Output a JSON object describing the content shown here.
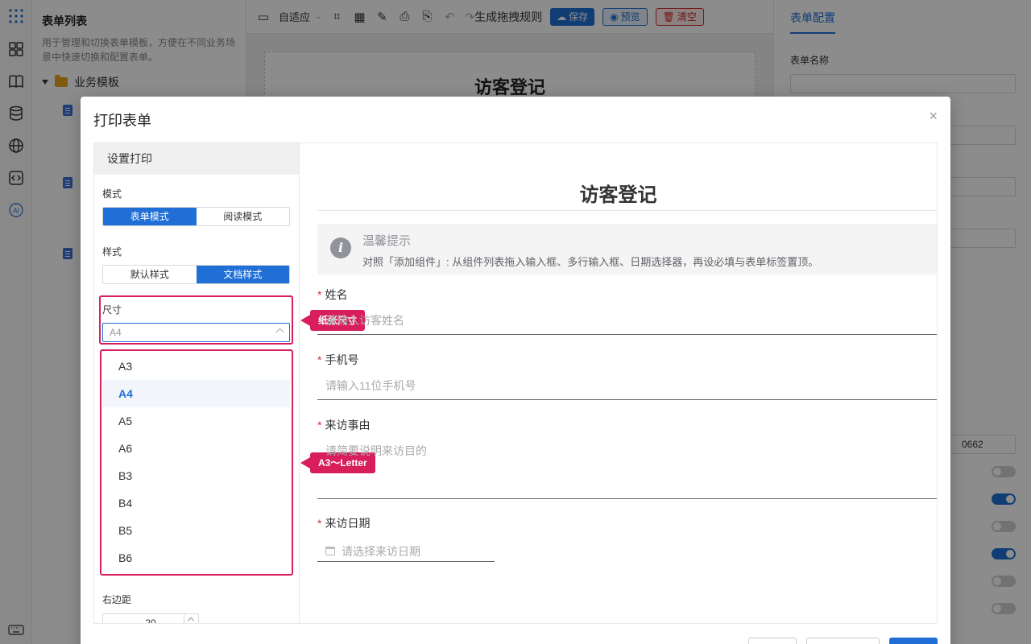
{
  "sidebar": {
    "title": "表单列表",
    "description": "用于管理和切换表单模板，方便在不同业务场景中快速切换和配置表单。",
    "folder": "业务模板"
  },
  "toolbar": {
    "adapt_label": "自适应",
    "generate_rules": "生成拖拽规则",
    "save": "保存",
    "preview": "预览",
    "clear": "清空"
  },
  "canvas": {
    "title": "访客登记"
  },
  "config": {
    "tab": "表单配置",
    "form_name_label": "表单名称",
    "partial_value": "0662"
  },
  "modal": {
    "title": "打印表单",
    "close": "×",
    "settings": {
      "header": "设置打印",
      "mode_label": "模式",
      "mode_options": [
        "表单模式",
        "阅读模式"
      ],
      "style_label": "样式",
      "style_options": [
        "默认样式",
        "文档样式"
      ],
      "size_label": "尺寸",
      "size_value": "A4",
      "size_options": [
        "A3",
        "A4",
        "A5",
        "A6",
        "B3",
        "B4",
        "B5",
        "B6"
      ],
      "right_margin_label": "右边距",
      "right_margin_value": "20"
    },
    "callouts": {
      "paper_size": "纸张尺寸",
      "range": "A3～Letter"
    },
    "preview": {
      "title": "访客登记",
      "notice_title": "温馨提示",
      "notice_desc": "对照「添加组件」: 从组件列表拖入输入框、多行输入框、日期选择器，再设必填与表单标签置顶。",
      "required_mark": "*",
      "fields": [
        {
          "label": "姓名",
          "placeholder": "请输入访客姓名"
        },
        {
          "label": "手机号",
          "placeholder": "请输入11位手机号"
        },
        {
          "label": "来访事由",
          "placeholder": "请简要说明来访目的"
        },
        {
          "label": "来访日期",
          "placeholder": "请选择来访日期"
        }
      ]
    }
  },
  "colors": {
    "accent": "#1f6fd6",
    "highlight": "#d81e5b",
    "required": "#d42a2a"
  }
}
